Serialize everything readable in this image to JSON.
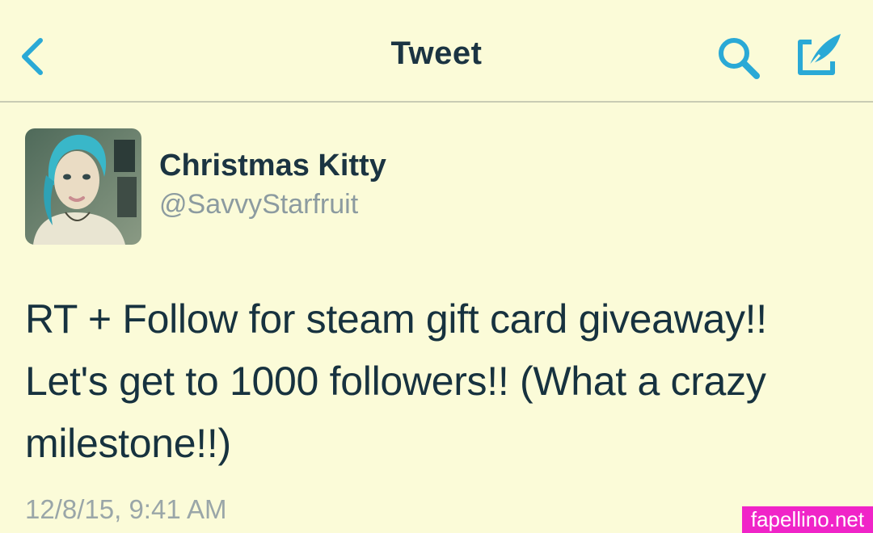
{
  "header": {
    "title": "Tweet",
    "back_icon": "chevron-left-icon",
    "search_icon": "search-icon",
    "compose_icon": "compose-tweet-icon",
    "accent_color": "#2aa9d6"
  },
  "tweet": {
    "display_name": "Christmas Kitty",
    "handle": "@SavvyStarfruit",
    "text": "RT + Follow for steam gift card giveaway!! Let's get to 1000 followers!! (What a crazy milestone!!)",
    "timestamp": "12/8/15, 9:41 AM"
  },
  "watermark": {
    "text": "fapellino.net",
    "color": "#f024c8"
  }
}
